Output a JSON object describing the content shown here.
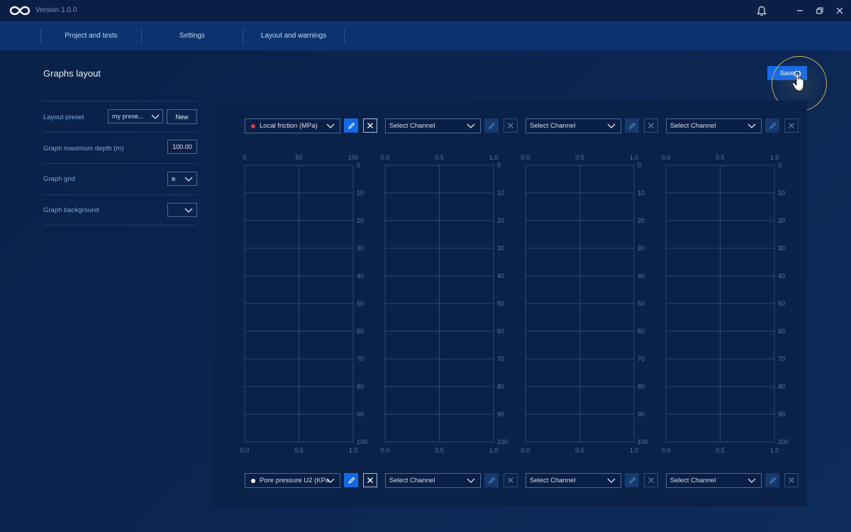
{
  "titlebar": {
    "version": "Version 1.0.0"
  },
  "nav": {
    "tabs": [
      "Project and tests",
      "Settings",
      "Layout and warnings"
    ]
  },
  "page": {
    "title": "Graphs layout",
    "save_label": "Save"
  },
  "settings": {
    "layout_preset_label": "Layout preset",
    "layout_preset_value": "my prese...",
    "new_label": "New",
    "max_depth_label": "Graph maximum depth (m)",
    "max_depth_value": "100.00",
    "grid_label": "Graph grid",
    "background_label": "Graph background"
  },
  "graphs": {
    "top_channels": [
      "Local friction (MPa)",
      "Select Channel",
      "Select Channel",
      "Select Channel"
    ],
    "bottom_channels": [
      "Pore pressure U2 (KPa",
      "Select Channel",
      "Select Channel",
      "Select Channel"
    ],
    "top_colors": [
      "#e0393e",
      "",
      "",
      ""
    ],
    "bottom_colors": [
      "#ffffff",
      "",
      "",
      ""
    ],
    "top_axes": [
      [
        "0",
        "50",
        "100"
      ],
      [
        "0.0",
        "0.5",
        "1.0"
      ],
      [
        "0.0",
        "0.5",
        "1.0"
      ],
      [
        "0.0",
        "0.5",
        "1.0"
      ]
    ],
    "bottom_axes": [
      [
        "0.0",
        "0.5",
        "1.0"
      ],
      [
        "0.0",
        "0.5",
        "1.0"
      ],
      [
        "0.0",
        "0.5",
        "1.0"
      ],
      [
        "0.0",
        "0.5",
        "1.0"
      ]
    ],
    "depth_ticks": [
      "0",
      "10",
      "20",
      "30",
      "40",
      "50",
      "60",
      "70",
      "80",
      "90",
      "100"
    ]
  },
  "colors": {
    "accent": "#1469e6",
    "grid_line": "#2a4670",
    "highlight": "#d6b35a"
  }
}
